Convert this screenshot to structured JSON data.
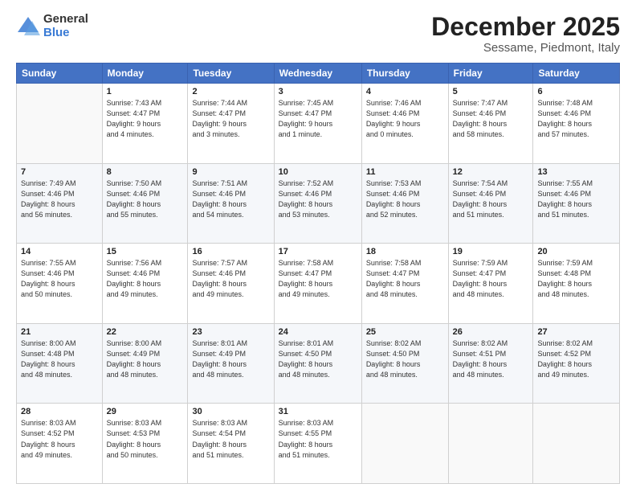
{
  "logo": {
    "general": "General",
    "blue": "Blue"
  },
  "title": "December 2025",
  "subtitle": "Sessame, Piedmont, Italy",
  "days_header": [
    "Sunday",
    "Monday",
    "Tuesday",
    "Wednesday",
    "Thursday",
    "Friday",
    "Saturday"
  ],
  "weeks": [
    [
      {
        "day": "",
        "info": ""
      },
      {
        "day": "1",
        "info": "Sunrise: 7:43 AM\nSunset: 4:47 PM\nDaylight: 9 hours\nand 4 minutes."
      },
      {
        "day": "2",
        "info": "Sunrise: 7:44 AM\nSunset: 4:47 PM\nDaylight: 9 hours\nand 3 minutes."
      },
      {
        "day": "3",
        "info": "Sunrise: 7:45 AM\nSunset: 4:47 PM\nDaylight: 9 hours\nand 1 minute."
      },
      {
        "day": "4",
        "info": "Sunrise: 7:46 AM\nSunset: 4:46 PM\nDaylight: 9 hours\nand 0 minutes."
      },
      {
        "day": "5",
        "info": "Sunrise: 7:47 AM\nSunset: 4:46 PM\nDaylight: 8 hours\nand 58 minutes."
      },
      {
        "day": "6",
        "info": "Sunrise: 7:48 AM\nSunset: 4:46 PM\nDaylight: 8 hours\nand 57 minutes."
      }
    ],
    [
      {
        "day": "7",
        "info": "Sunrise: 7:49 AM\nSunset: 4:46 PM\nDaylight: 8 hours\nand 56 minutes."
      },
      {
        "day": "8",
        "info": "Sunrise: 7:50 AM\nSunset: 4:46 PM\nDaylight: 8 hours\nand 55 minutes."
      },
      {
        "day": "9",
        "info": "Sunrise: 7:51 AM\nSunset: 4:46 PM\nDaylight: 8 hours\nand 54 minutes."
      },
      {
        "day": "10",
        "info": "Sunrise: 7:52 AM\nSunset: 4:46 PM\nDaylight: 8 hours\nand 53 minutes."
      },
      {
        "day": "11",
        "info": "Sunrise: 7:53 AM\nSunset: 4:46 PM\nDaylight: 8 hours\nand 52 minutes."
      },
      {
        "day": "12",
        "info": "Sunrise: 7:54 AM\nSunset: 4:46 PM\nDaylight: 8 hours\nand 51 minutes."
      },
      {
        "day": "13",
        "info": "Sunrise: 7:55 AM\nSunset: 4:46 PM\nDaylight: 8 hours\nand 51 minutes."
      }
    ],
    [
      {
        "day": "14",
        "info": "Sunrise: 7:55 AM\nSunset: 4:46 PM\nDaylight: 8 hours\nand 50 minutes."
      },
      {
        "day": "15",
        "info": "Sunrise: 7:56 AM\nSunset: 4:46 PM\nDaylight: 8 hours\nand 49 minutes."
      },
      {
        "day": "16",
        "info": "Sunrise: 7:57 AM\nSunset: 4:46 PM\nDaylight: 8 hours\nand 49 minutes."
      },
      {
        "day": "17",
        "info": "Sunrise: 7:58 AM\nSunset: 4:47 PM\nDaylight: 8 hours\nand 49 minutes."
      },
      {
        "day": "18",
        "info": "Sunrise: 7:58 AM\nSunset: 4:47 PM\nDaylight: 8 hours\nand 48 minutes."
      },
      {
        "day": "19",
        "info": "Sunrise: 7:59 AM\nSunset: 4:47 PM\nDaylight: 8 hours\nand 48 minutes."
      },
      {
        "day": "20",
        "info": "Sunrise: 7:59 AM\nSunset: 4:48 PM\nDaylight: 8 hours\nand 48 minutes."
      }
    ],
    [
      {
        "day": "21",
        "info": "Sunrise: 8:00 AM\nSunset: 4:48 PM\nDaylight: 8 hours\nand 48 minutes."
      },
      {
        "day": "22",
        "info": "Sunrise: 8:00 AM\nSunset: 4:49 PM\nDaylight: 8 hours\nand 48 minutes."
      },
      {
        "day": "23",
        "info": "Sunrise: 8:01 AM\nSunset: 4:49 PM\nDaylight: 8 hours\nand 48 minutes."
      },
      {
        "day": "24",
        "info": "Sunrise: 8:01 AM\nSunset: 4:50 PM\nDaylight: 8 hours\nand 48 minutes."
      },
      {
        "day": "25",
        "info": "Sunrise: 8:02 AM\nSunset: 4:50 PM\nDaylight: 8 hours\nand 48 minutes."
      },
      {
        "day": "26",
        "info": "Sunrise: 8:02 AM\nSunset: 4:51 PM\nDaylight: 8 hours\nand 48 minutes."
      },
      {
        "day": "27",
        "info": "Sunrise: 8:02 AM\nSunset: 4:52 PM\nDaylight: 8 hours\nand 49 minutes."
      }
    ],
    [
      {
        "day": "28",
        "info": "Sunrise: 8:03 AM\nSunset: 4:52 PM\nDaylight: 8 hours\nand 49 minutes."
      },
      {
        "day": "29",
        "info": "Sunrise: 8:03 AM\nSunset: 4:53 PM\nDaylight: 8 hours\nand 50 minutes."
      },
      {
        "day": "30",
        "info": "Sunrise: 8:03 AM\nSunset: 4:54 PM\nDaylight: 8 hours\nand 51 minutes."
      },
      {
        "day": "31",
        "info": "Sunrise: 8:03 AM\nSunset: 4:55 PM\nDaylight: 8 hours\nand 51 minutes."
      },
      {
        "day": "",
        "info": ""
      },
      {
        "day": "",
        "info": ""
      },
      {
        "day": "",
        "info": ""
      }
    ]
  ]
}
